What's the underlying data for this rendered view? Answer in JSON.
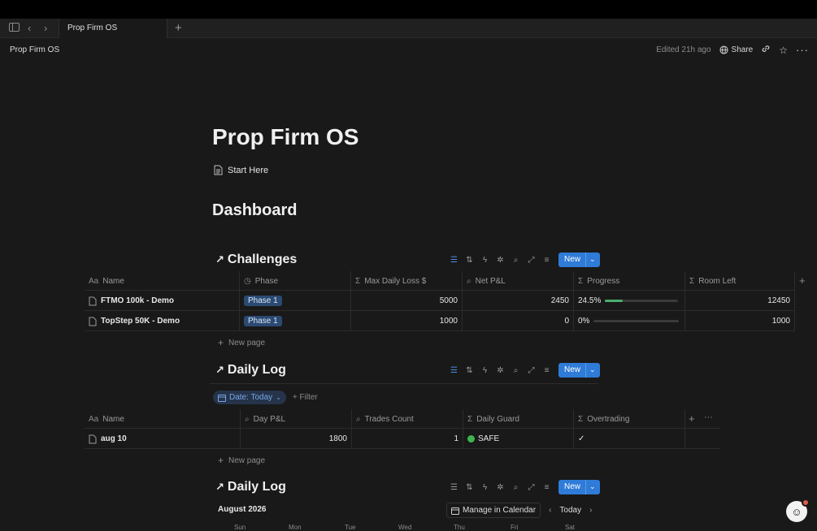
{
  "tab": {
    "title": "Prop Firm OS"
  },
  "header": {
    "breadcrumb": "Prop Firm OS",
    "edited": "Edited 21h ago",
    "share_label": "Share"
  },
  "page": {
    "title": "Prop Firm OS",
    "start_link": "Start Here",
    "dashboard_heading": "Dashboard"
  },
  "toolbar": {
    "new_label": "New"
  },
  "challenges": {
    "title": "Challenges",
    "columns": [
      "Name",
      "Phase",
      "Max Daily Loss $",
      "Net P&L",
      "Progress",
      "Room Left"
    ],
    "rows": [
      {
        "name": "FTMO 100k - Demo",
        "phase": "Phase 1",
        "max_daily_loss": "5000",
        "net_pnl": "2450",
        "progress": "24.5%",
        "progress_value": 0.245,
        "room_left": "12450"
      },
      {
        "name": "TopStep 50K - Demo",
        "phase": "Phase 1",
        "max_daily_loss": "1000",
        "net_pnl": "0",
        "progress": "0%",
        "progress_value": 0,
        "room_left": "1000"
      }
    ],
    "new_page": "New page"
  },
  "daily_log": {
    "title": "Daily Log",
    "filter_chip": "Date: Today",
    "add_filter": "Filter",
    "columns": [
      "Name",
      "Day P&L",
      "Trades Count",
      "Daily Guard",
      "Overtrading"
    ],
    "rows": [
      {
        "name": "aug 10",
        "day_pnl": "1800",
        "trades_count": "1",
        "daily_guard": "SAFE",
        "overtrading": "✓"
      }
    ],
    "new_page": "New page"
  },
  "calendar": {
    "title": "Daily Log",
    "month": "August 2026",
    "manage_label": "Manage in Calendar",
    "today_label": "Today",
    "days": [
      "Sun",
      "Mon",
      "Tue",
      "Wed",
      "Thu",
      "Fri",
      "Sat"
    ]
  },
  "colors": {
    "accent": "#2f7bd8",
    "phase_pill": "#2b4a72",
    "progress": "#4cae6b",
    "safe": "#3fb34f"
  }
}
